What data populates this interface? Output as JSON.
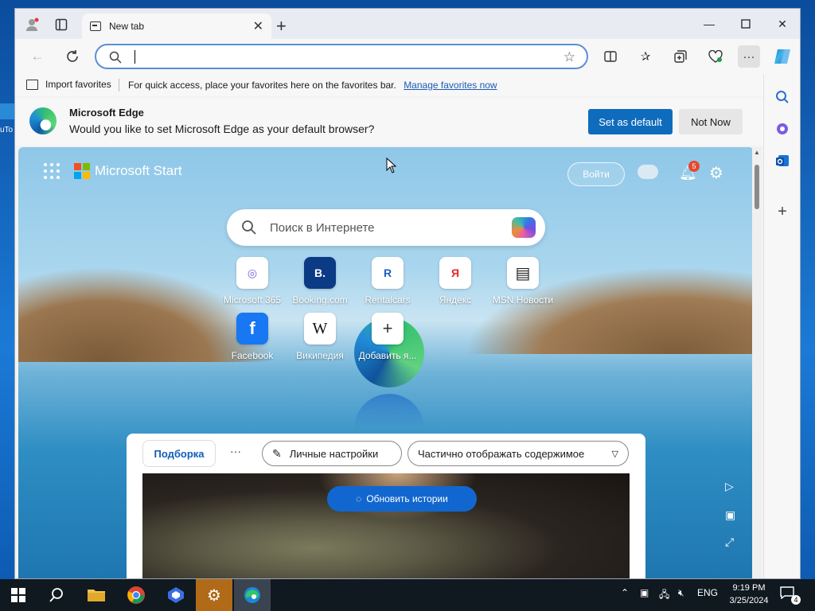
{
  "desktop": {
    "left_label": "uTo"
  },
  "titlebar": {
    "tab_title": "New tab",
    "window_controls": [
      "minimize",
      "maximize",
      "close"
    ]
  },
  "toolbar": {
    "address_value": "",
    "icons": [
      "back-icon",
      "refresh-icon",
      "search-icon",
      "favorite-star-icon",
      "split-screen-icon",
      "favorites-icon",
      "collections-icon",
      "browser-essentials-icon",
      "more-icon",
      "copilot-icon"
    ]
  },
  "favorites_bar": {
    "import_label": "Import favorites",
    "hint": "For quick access, place your favorites here on the favorites bar.",
    "manage_link": "Manage favorites now"
  },
  "infobar": {
    "title": "Microsoft Edge",
    "message": "Would you like to set Microsoft Edge as your default browser?",
    "primary_button": "Set as default",
    "secondary_button": "Not Now"
  },
  "new_tab": {
    "brand": "Microsoft Start",
    "login_button": "Войти",
    "notification_count": "5",
    "search_placeholder": "Поиск в Интернете",
    "quick_links": [
      {
        "label": "Microsoft 365",
        "glyph": "◎"
      },
      {
        "label": "Booking.com",
        "glyph": "B."
      },
      {
        "label": "Rentalcars",
        "glyph": "R"
      },
      {
        "label": "Яндекс",
        "glyph": "Я"
      },
      {
        "label": "MSN Новости",
        "glyph": "▤"
      },
      {
        "label": "Facebook",
        "glyph": "f"
      },
      {
        "label": "Википедия",
        "glyph": "W"
      },
      {
        "label": "Добавить я...",
        "glyph": "+"
      }
    ],
    "feed": {
      "tab_label": "Подборка",
      "more": "···",
      "personal_settings": "Личные настройки",
      "display_mode": "Частично отображать содержимое",
      "refresh_button": "Обновить истории"
    }
  },
  "taskbar": {
    "language": "ENG",
    "time": "9:19 PM",
    "date": "3/25/2024",
    "notification_count": "4"
  },
  "colors": {
    "accent": "#0f6cbd",
    "taskbar": "#101820",
    "refresh_button": "#1167cf"
  }
}
